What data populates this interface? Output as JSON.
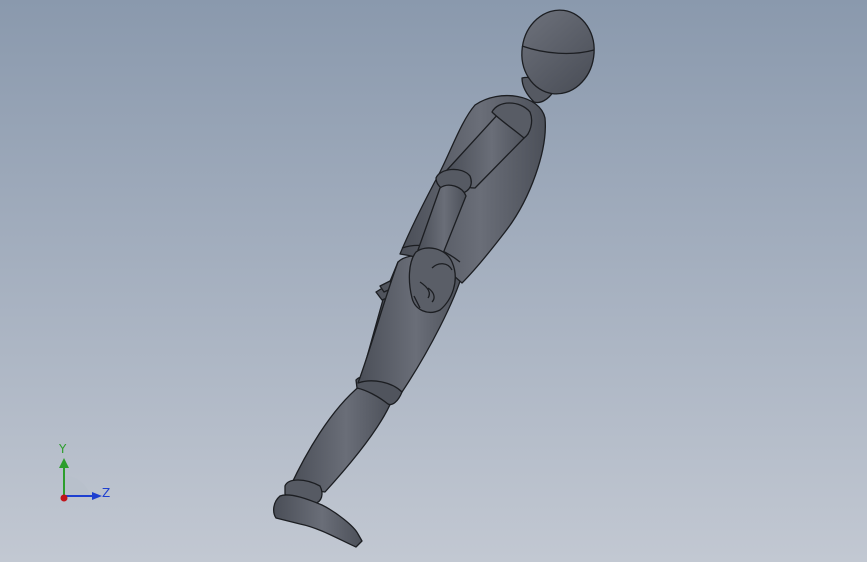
{
  "viewport": {
    "background_top": "#8a99ad",
    "background_bottom": "#c2c8d2"
  },
  "model": {
    "subject": "mannequin-figure",
    "body_color": "#5b5f69",
    "edge_color": "#1c1e22"
  },
  "triad": {
    "y_label": "Y",
    "z_label": "Z",
    "y_color": "#2c9e2c",
    "z_color": "#1e3fd0",
    "x_color": "#c0141a"
  }
}
